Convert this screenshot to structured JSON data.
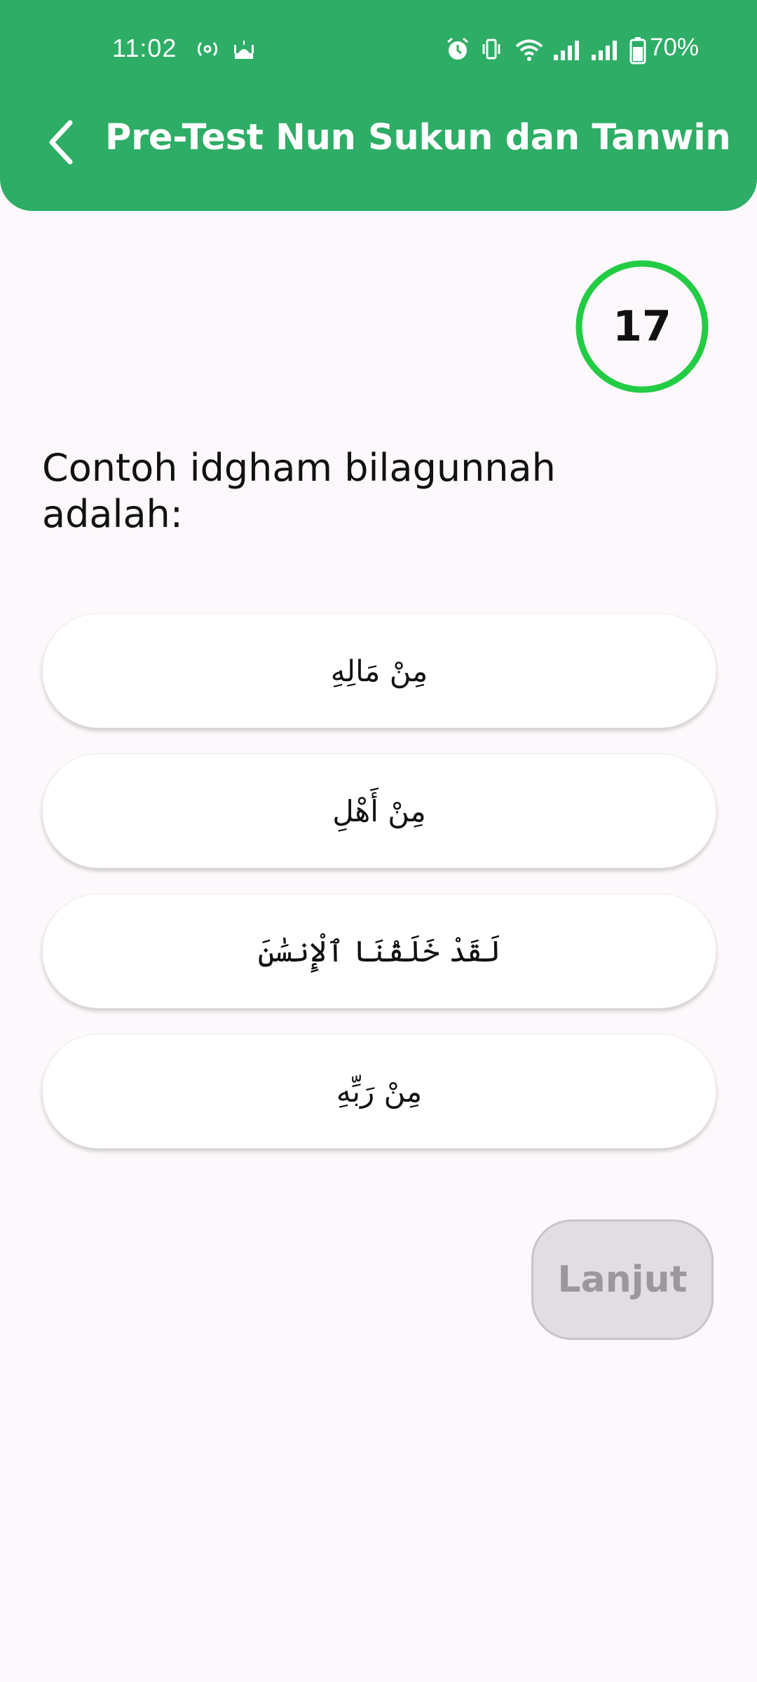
{
  "status_bar": {
    "time": "11:02",
    "battery": "70%",
    "icons": [
      "radio-icon",
      "mosque-icon",
      "alarm-icon",
      "vibrate-icon",
      "wifi-icon",
      "signal-icon",
      "signal-icon",
      "battery-icon"
    ]
  },
  "header": {
    "title": "Pre-Test Nun Sukun dan Tanwin",
    "back_icon": "chevron-left-icon",
    "color": "#2dad65"
  },
  "timer": {
    "value": "17",
    "ring_color": "#22cc44"
  },
  "question": {
    "text": "Contoh idgham bilagunnah adalah:"
  },
  "options": [
    {
      "label": "مِنْ مَالِهِ"
    },
    {
      "label": "مِنْ أَهْلِ"
    },
    {
      "label": "لَقَدْ خَلَقْنَا ٱلْإِنسَٰنَ"
    },
    {
      "label": "مِنْ رَبِّهِ"
    }
  ],
  "next_button": {
    "label": "Lanjut"
  }
}
